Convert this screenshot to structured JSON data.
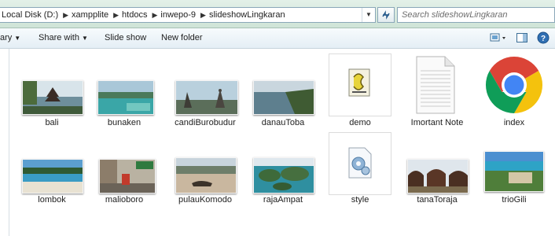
{
  "address": {
    "crumbs": [
      "Local Disk (D:)",
      "xampplite",
      "htdocs",
      "inwepo-9",
      "slideshowLingkaran"
    ]
  },
  "search": {
    "placeholder": "Search slideshowLingkaran"
  },
  "toolbar": {
    "library_label": "ary",
    "share_label": "Share with",
    "slideshow_label": "Slide show",
    "newfolder_label": "New folder"
  },
  "files": {
    "row1": [
      {
        "name": "bali"
      },
      {
        "name": "bunaken"
      },
      {
        "name": "candiBurobudur"
      },
      {
        "name": "danauToba"
      },
      {
        "name": "demo"
      },
      {
        "name": "Imortant Note"
      },
      {
        "name": "index"
      }
    ],
    "row2": [
      {
        "name": "lombok"
      },
      {
        "name": "malioboro"
      },
      {
        "name": "pulauKomodo"
      },
      {
        "name": "rajaAmpat"
      },
      {
        "name": "style"
      },
      {
        "name": "tanaToraja"
      },
      {
        "name": "trioGili"
      }
    ]
  },
  "icons": {
    "refresh": "refresh-icon",
    "search": "search-icon",
    "views": "views-icon",
    "pane": "preview-pane-icon",
    "help": "help-icon",
    "chrome": "chrome-icon"
  }
}
